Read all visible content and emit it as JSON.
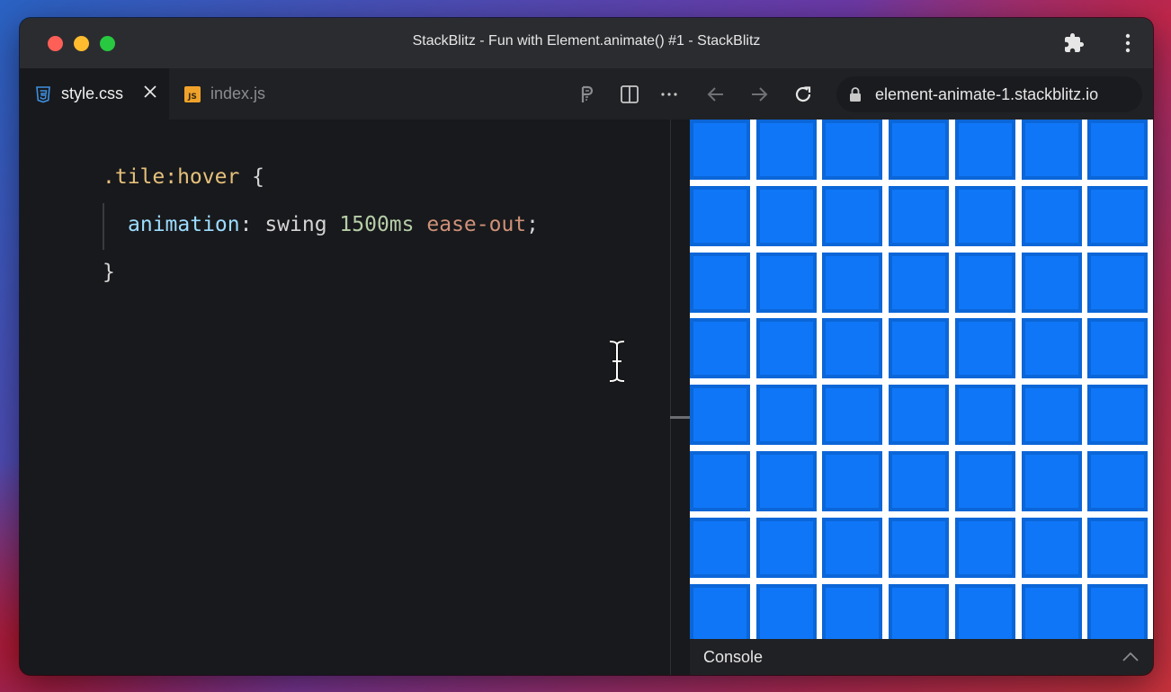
{
  "window": {
    "title": "StackBlitz - Fun with Element.animate() #1 - StackBlitz"
  },
  "tabs": [
    {
      "label": "style.css",
      "active": true,
      "icon": "css-file-icon"
    },
    {
      "label": "index.js",
      "active": false,
      "icon": "js-file-icon"
    }
  ],
  "js_badge": "JS",
  "toolbar": {
    "icons": [
      "prettier-icon",
      "split-view-icon",
      "more-icon",
      "back-arrow-icon",
      "forward-arrow-icon",
      "reload-icon"
    ]
  },
  "address": {
    "url": "element-animate-1.stackblitz.io"
  },
  "editor": {
    "line1": {
      "selector": ".tile:hover",
      "brace_open": " {"
    },
    "line2": {
      "property": "animation",
      "colon": ": ",
      "value1": "swing ",
      "value2": "1500ms",
      "space": " ",
      "value3": "ease-out",
      "semicolon": ";"
    },
    "line3": {
      "brace_close": "}"
    }
  },
  "preview": {
    "tile_color": "#0f77f7",
    "tile_border": "#0b66d8",
    "columns": 7,
    "rows": 8
  },
  "console": {
    "label": "Console"
  },
  "colors": {
    "traffic_red": "#fe5f57",
    "traffic_yellow": "#febc2e",
    "traffic_green": "#28c840",
    "editor_bg": "#18191c",
    "css_icon": "#3d8fe0",
    "js_icon": "#f0a32a"
  }
}
